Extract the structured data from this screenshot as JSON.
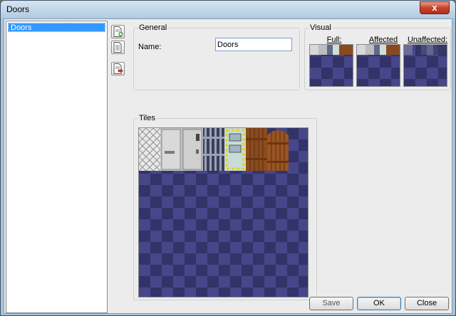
{
  "window": {
    "title": "Doors",
    "close_glyph": "x"
  },
  "sidebar": {
    "items": [
      {
        "label": "Doors",
        "selected": true
      }
    ]
  },
  "toolbar": {
    "buttons": [
      {
        "icon": "new-page-icon"
      },
      {
        "icon": "copy-page-icon"
      },
      {
        "icon": "delete-page-icon"
      }
    ]
  },
  "general": {
    "title": "General",
    "name_label": "Name:",
    "name_value": "Doors"
  },
  "visual": {
    "title": "Visual",
    "full_label": "Full:",
    "affected_label": "Affected",
    "unaffected_label": "Unaffected:"
  },
  "tiles": {
    "title": "Tiles",
    "items": [
      {
        "name": "chain-fence-tile"
      },
      {
        "name": "steel-door-tile"
      },
      {
        "name": "steel-door-window-tile"
      },
      {
        "name": "bars-door-tile"
      },
      {
        "name": "hazard-door-tile"
      },
      {
        "name": "wooden-door-tile"
      },
      {
        "name": "wooden-arch-door-tile"
      }
    ]
  },
  "buttons": {
    "save": "Save",
    "ok": "OK",
    "close": "Close"
  },
  "colors": {
    "checker_light": "#464689",
    "checker_dark": "#33336a",
    "selection": "#3399ff"
  }
}
